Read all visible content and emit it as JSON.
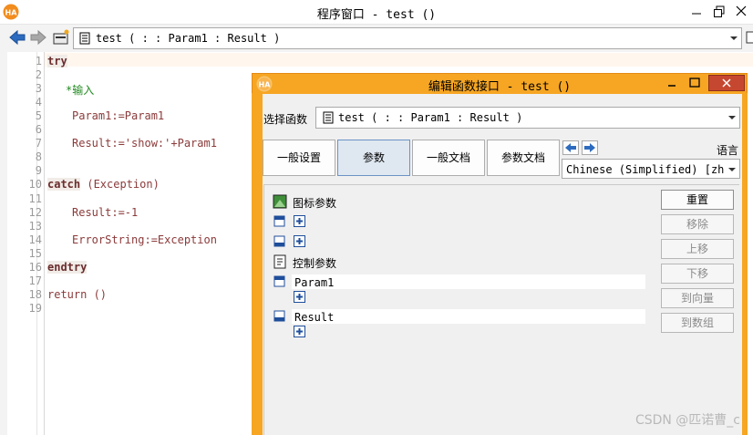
{
  "main_window": {
    "title": "程序窗口 - test ()",
    "procedure_combo": "test ( : : Param1 : Result )"
  },
  "editor": {
    "lines": [
      {
        "no": "1",
        "text": "try",
        "kind": "keyword"
      },
      {
        "no": "2",
        "text": "",
        "kind": "code"
      },
      {
        "no": "3",
        "text": "*输入",
        "kind": "comment"
      },
      {
        "no": "4",
        "text": "",
        "kind": "code"
      },
      {
        "no": "5",
        "text": "Param1:=Param1",
        "kind": "code"
      },
      {
        "no": "6",
        "text": "",
        "kind": "code"
      },
      {
        "no": "7",
        "text": "Result:='show:'+Param1",
        "kind": "code"
      },
      {
        "no": "8",
        "text": "",
        "kind": "code"
      },
      {
        "no": "9",
        "text": "",
        "kind": "code"
      },
      {
        "no": "10",
        "text": "catch",
        "suffix": " (Exception)",
        "kind": "keyword"
      },
      {
        "no": "11",
        "text": "",
        "kind": "code"
      },
      {
        "no": "12",
        "text": "Result:=-1",
        "kind": "code"
      },
      {
        "no": "13",
        "text": "",
        "kind": "code"
      },
      {
        "no": "14",
        "text": "ErrorString:=Exception",
        "kind": "code"
      },
      {
        "no": "15",
        "text": "",
        "kind": "code"
      },
      {
        "no": "16",
        "text": "endtry",
        "kind": "keyword"
      },
      {
        "no": "17",
        "text": "",
        "kind": "code"
      },
      {
        "no": "18",
        "text": "return ()",
        "kind": "code"
      },
      {
        "no": "19",
        "text": "",
        "kind": "code"
      }
    ]
  },
  "dialog": {
    "title": "编辑函数接口 - test ()",
    "select_label": "选择函数",
    "select_value": "test ( : : Param1 : Result )",
    "tabs": [
      {
        "line1": "一般",
        "line2": "设置"
      },
      {
        "line1": "参数",
        "line2": ""
      },
      {
        "line1": "一般",
        "line2": "文档"
      },
      {
        "line1": "参数",
        "line2": "文档"
      }
    ],
    "language_label": "语言",
    "language_value": "Chinese (Simplified) [zh",
    "params": {
      "icon_section": "图标参数",
      "control_section": "控制参数",
      "control_in": "Param1",
      "control_out": "Result"
    },
    "buttons": {
      "reset": "重置",
      "remove": "移除",
      "up": "上移",
      "down": "下移",
      "to_vector": "到向量",
      "to_array": "到数组"
    }
  },
  "watermark": "CSDN @匹诺曹_c"
}
